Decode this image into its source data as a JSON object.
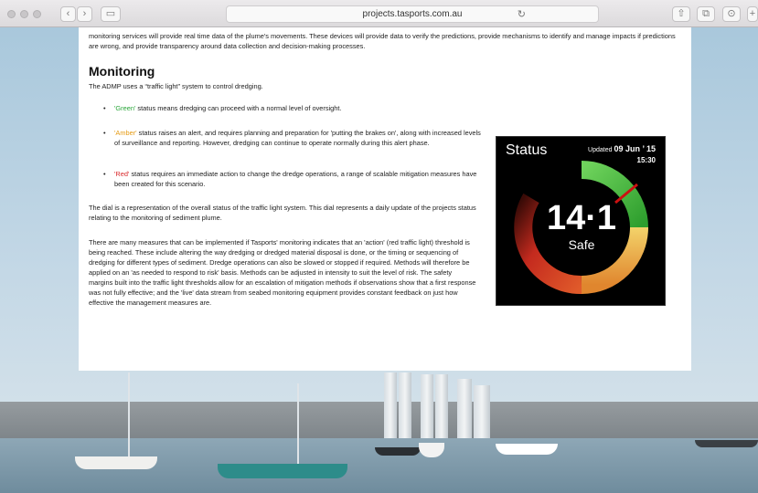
{
  "browser": {
    "url": "projects.tasports.com.au"
  },
  "article": {
    "intro": "monitoring services will provide real time data of the plume's movements. These devices will provide data to verify the predictions, provide mechanisms to identify and manage impacts if predictions are wrong, and provide transparency around data collection and decision-making processes.",
    "heading": "Monitoring",
    "lead": "The ADMP uses a “traffic light” system to control dredging.",
    "bullets": {
      "green_word": "'Green'",
      "green_text": " status means dredging can proceed with a normal level of oversight.",
      "amber_word": "'Amber'",
      "amber_text": " status raises an alert, and requires planning and preparation for 'putting the brakes on', along with increased levels of surveillance and reporting. However, dredging can continue to operate normally during this alert phase.",
      "red_word": "'Red'",
      "red_text": " status requires an immediate action to change the dredge operations, a range of scalable mitigation measures have been created for this scenario."
    },
    "dial_paragraph": "The dial is a representation of the overall status of the traffic light system. This dial represents a daily update of the projects status relating to the monitoring of sediment plume.",
    "measures_paragraph": "There are many measures that can be implemented if Tasports' monitoring indicates that an 'action' (red traffic light) threshold is being reached.  These include altering the way dredging or dredged material disposal is done, or the timing or sequencing of dredging for different types of sediment.  Dredge operations can also be slowed or stopped if required.  Methods will therefore be applied on an 'as needed to respond to risk' basis. Methods can be adjusted in intensity to suit the level of risk.  The safety margins built into the traffic light thresholds allow for an escalation of mitigation methods if observations show that a first response was not fully effective; and the 'live' data stream from seabed monitoring equipment provides constant feedback on just how effective the management measures are."
  },
  "dial": {
    "title": "Status",
    "updated_label": "Updated",
    "date": "09 Jun ’ 15",
    "time": "15:30",
    "value": "14·1",
    "status": "Safe",
    "colors": {
      "green": "#2e9e2e",
      "amber": "#e8a83a",
      "red": "#d63a24",
      "needle": "#cc1111"
    }
  }
}
